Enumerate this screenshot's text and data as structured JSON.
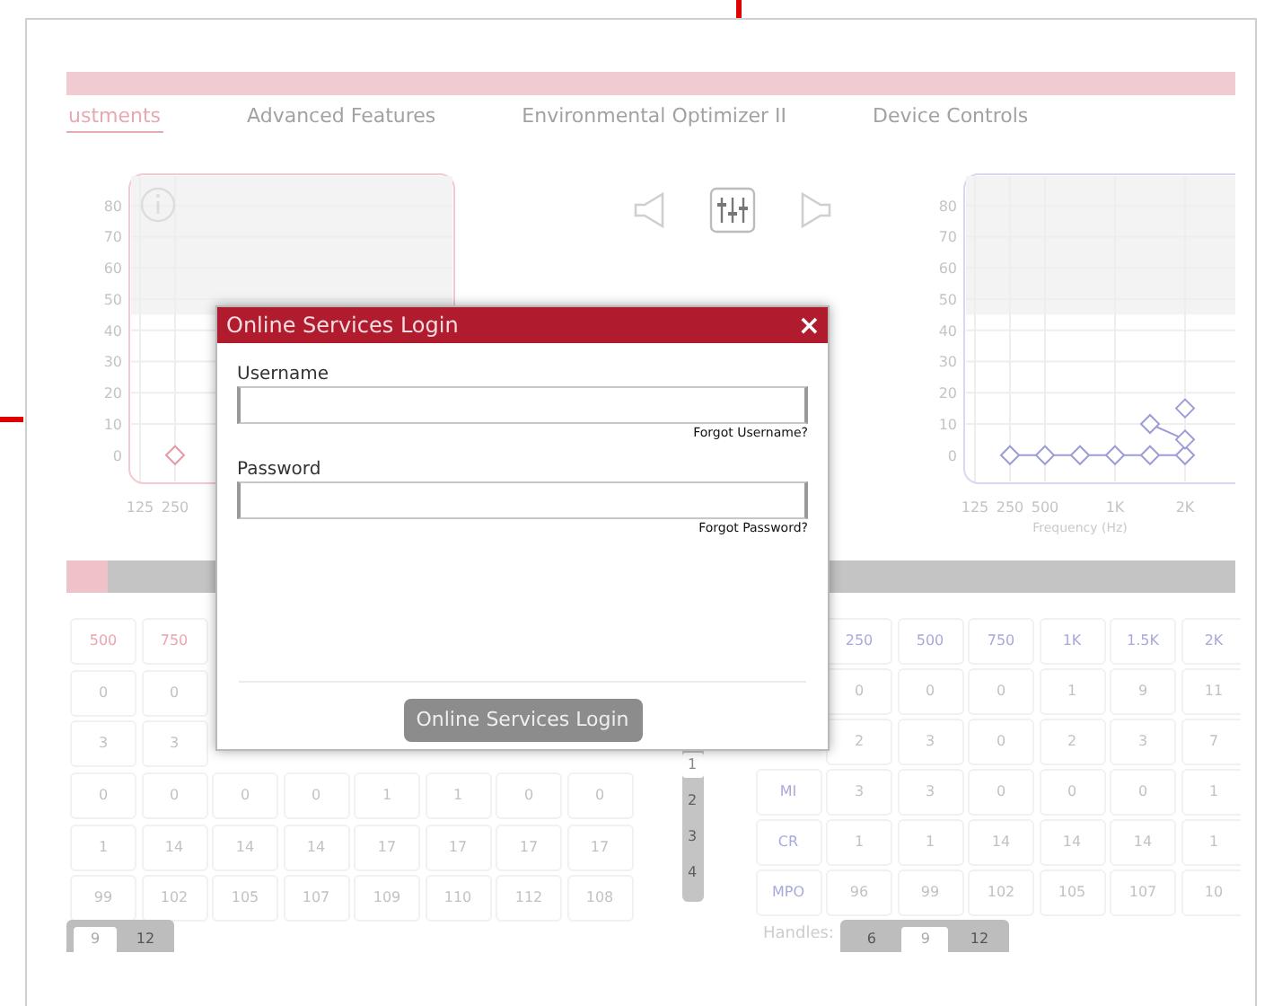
{
  "tabs": [
    {
      "label": "ustments",
      "selected": true
    },
    {
      "label": "Advanced Features",
      "selected": false
    },
    {
      "label": "Environmental Optimizer II",
      "selected": false
    },
    {
      "label": "Device Controls",
      "selected": false
    }
  ],
  "left_chart": {
    "chart_data": {
      "type": "line",
      "grid": true,
      "ylim": [
        -9,
        90
      ],
      "bands": [
        {
          "axis": "y",
          "from": 45,
          "to": 90
        }
      ],
      "categories": [
        "125",
        "250"
      ],
      "yticks": [
        0,
        10,
        20,
        30,
        40,
        50,
        60,
        70,
        80
      ],
      "series": [
        {
          "color": "#e49aa6",
          "marker": "diamond",
          "values": [
            null,
            0
          ]
        }
      ]
    }
  },
  "right_chart": {
    "chart_data": {
      "type": "line",
      "grid": true,
      "ylim": [
        -9,
        90
      ],
      "bands": [
        {
          "axis": "y",
          "from": 45,
          "to": 90
        }
      ],
      "xlabel": "Frequency (Hz)",
      "categories": [
        "125",
        "250",
        "500",
        null,
        "1K",
        null,
        "2K"
      ],
      "yticks": [
        0,
        10,
        20,
        30,
        40,
        50,
        60,
        70,
        80
      ],
      "series": [
        {
          "color": "#9c9cd6",
          "marker": "diamond",
          "values": [
            null,
            0,
            0,
            0,
            0,
            0,
            0
          ]
        },
        {
          "color": "#9c9cd6",
          "marker": "diamond",
          "values": [
            null,
            null,
            null,
            null,
            null,
            10,
            5
          ]
        },
        {
          "color": "#9c9cd6",
          "marker": "diamond",
          "values": [
            null,
            null,
            null,
            null,
            null,
            null,
            15
          ]
        }
      ]
    }
  },
  "left_table": {
    "header": [
      "500",
      "750"
    ],
    "rows": [
      [
        "0",
        "0"
      ],
      [
        "3",
        "3"
      ],
      [
        "0",
        "0",
        "0",
        "0",
        "1",
        "1",
        "0",
        "0"
      ],
      [
        "1",
        "14",
        "14",
        "14",
        "17",
        "17",
        "17",
        "17"
      ],
      [
        "99",
        "102",
        "105",
        "107",
        "109",
        "110",
        "112",
        "108"
      ]
    ]
  },
  "pager": [
    {
      "label": "1",
      "selected": true
    },
    {
      "label": "2",
      "selected": false
    },
    {
      "label": "3",
      "selected": false
    },
    {
      "label": "4",
      "selected": false
    }
  ],
  "right_table": {
    "header": [
      "250",
      "500",
      "750",
      "1K",
      "1.5K",
      "2K"
    ],
    "rows": [
      [
        "",
        "0",
        "0",
        "0",
        "1",
        "9",
        "11"
      ],
      [
        "",
        "2",
        "3",
        "0",
        "2",
        "3",
        "7"
      ],
      [
        "MI",
        "3",
        "3",
        "0",
        "0",
        "0",
        "1"
      ],
      [
        "CR",
        "1",
        "1",
        "14",
        "14",
        "14",
        "1"
      ],
      [
        "MPO",
        "96",
        "99",
        "102",
        "105",
        "107",
        "10"
      ]
    ]
  },
  "left_toggle": [
    {
      "label": "9",
      "selected": true
    },
    {
      "label": "12",
      "selected": false
    }
  ],
  "handles": {
    "label": "Handles:",
    "options": [
      {
        "label": "6",
        "selected": false
      },
      {
        "label": "9",
        "selected": true
      },
      {
        "label": "12",
        "selected": false
      }
    ]
  },
  "dialog": {
    "title": "Online Services Login",
    "close": "×",
    "fields": [
      {
        "label": "Username",
        "link": "Forgot Username?"
      },
      {
        "label": "Password",
        "link": "Forgot Password?"
      }
    ],
    "button": "Online Services Login"
  }
}
